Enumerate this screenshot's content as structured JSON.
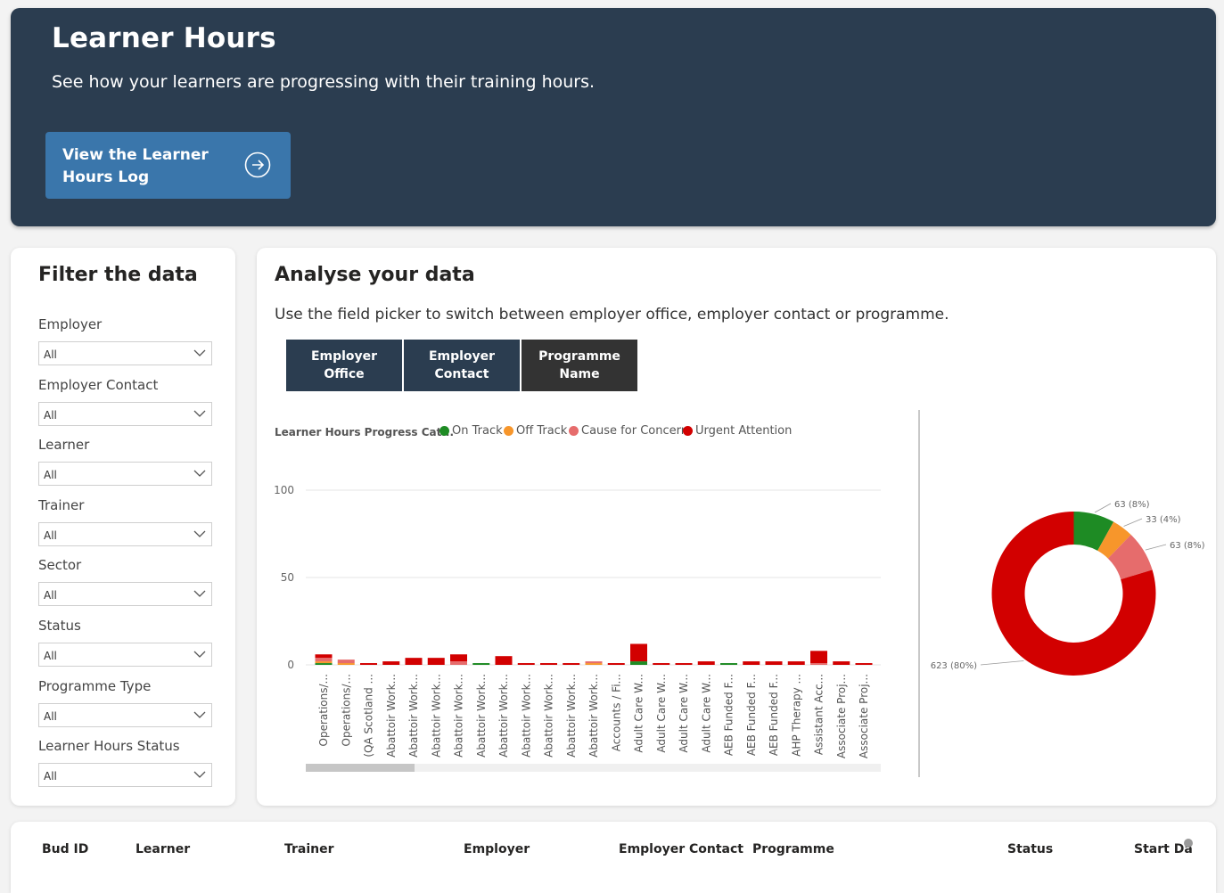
{
  "header": {
    "title": "Learner Hours",
    "subtitle": "See how your learners are progressing with their training hours.",
    "button_label": "View the Learner Hours Log"
  },
  "filters": {
    "title": "Filter the data",
    "items": [
      {
        "label": "Employer",
        "value": "All"
      },
      {
        "label": "Employer Contact",
        "value": "All"
      },
      {
        "label": "Learner",
        "value": "All"
      },
      {
        "label": "Trainer",
        "value": "All"
      },
      {
        "label": "Sector",
        "value": "All"
      },
      {
        "label": "Status",
        "value": "All"
      },
      {
        "label": "Programme Type",
        "value": "All"
      },
      {
        "label": "Learner Hours Status",
        "value": "All"
      }
    ]
  },
  "analyse": {
    "title": "Analyse your data",
    "description": "Use the field picker to switch between employer office, employer contact or programme.",
    "pickers": [
      {
        "label": "Employer Office",
        "selected": false
      },
      {
        "label": "Employer Contact",
        "selected": false
      },
      {
        "label": "Programme Name",
        "selected": true
      }
    ]
  },
  "colors": {
    "on_track": "#1e8b24",
    "off_track": "#f7962b",
    "concern": "#e66c6c",
    "urgent": "#d20000",
    "header_bg": "#2b3d50",
    "button_bg": "#3a76ab",
    "picker_bg": "#2b3d50",
    "picker_selected_bg": "#333333"
  },
  "chart_data": [
    {
      "type": "bar",
      "stacked": true,
      "legend_title": "Learner Hours Progress Cat...",
      "legend_position": "top-left",
      "ylim": [
        0,
        100
      ],
      "yticks": [
        0,
        50,
        100
      ],
      "grid": true,
      "categories": [
        "Operations/...",
        "Operations/...",
        "(QA Scotland ...",
        "Abattoir Work...",
        "Abattoir Work...",
        "Abattoir Work...",
        "Abattoir Work...",
        "Abattoir Work...",
        "Abattoir Work...",
        "Abattoir Work...",
        "Abattoir Work...",
        "Abattoir Work...",
        "Abattoir Work...",
        "Accounts / Fi...",
        "Adult Care W...",
        "Adult Care W...",
        "Adult Care W...",
        "Adult Care W...",
        "AEB Funded F...",
        "AEB Funded F...",
        "AEB Funded F...",
        "AHP Therapy ...",
        "Assistant Acc...",
        "Associate Proj...",
        "Associate Proj..."
      ],
      "series": [
        {
          "name": "On Track",
          "values": [
            1,
            0,
            0,
            0,
            0,
            0,
            0,
            1,
            0,
            0,
            0,
            0,
            0,
            0,
            2,
            0,
            0,
            0,
            1,
            0,
            0,
            0,
            0,
            0,
            0
          ]
        },
        {
          "name": "Off Track",
          "values": [
            1,
            1,
            0,
            0,
            0,
            0,
            0,
            0,
            0,
            0,
            0,
            0,
            1,
            0,
            0,
            0,
            0,
            0,
            0,
            0,
            0,
            0,
            0,
            0,
            0
          ]
        },
        {
          "name": "Cause for Concern",
          "values": [
            2,
            2,
            0,
            0,
            0,
            0,
            2,
            0,
            0,
            0,
            0,
            0,
            1,
            0,
            0,
            0,
            0,
            0,
            0,
            0,
            0,
            0,
            1,
            0,
            0
          ]
        },
        {
          "name": "Urgent Attention",
          "values": [
            2,
            0,
            1,
            2,
            4,
            4,
            4,
            0,
            5,
            1,
            1,
            1,
            0,
            1,
            10,
            1,
            1,
            2,
            0,
            2,
            2,
            2,
            7,
            2,
            1
          ]
        }
      ],
      "data_labels": [
        {
          "index": 6,
          "text": "6"
        },
        {
          "index": 8,
          "text": "5"
        },
        {
          "index": 14,
          "text": "12"
        },
        {
          "index": 22,
          "text": "8"
        }
      ]
    },
    {
      "type": "pie",
      "donut": true,
      "slices": [
        {
          "name": "On Track",
          "value": 63,
          "label": "63 (8%)"
        },
        {
          "name": "Off Track",
          "value": 33,
          "label": "33 (4%)"
        },
        {
          "name": "Cause for Concern",
          "value": 63,
          "label": "63 (8%)"
        },
        {
          "name": "Urgent Attention",
          "value": 623,
          "label": "623 (80%)"
        }
      ]
    }
  ],
  "table": {
    "columns": [
      "Bud ID",
      "Learner",
      "Trainer",
      "Employer",
      "Employer Contact",
      "Programme",
      "Status",
      "Start Da"
    ]
  }
}
